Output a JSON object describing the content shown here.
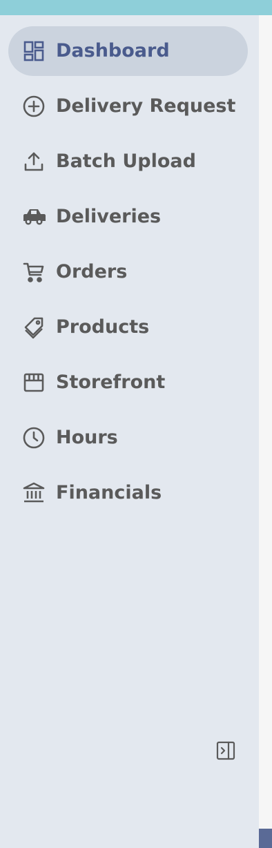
{
  "sidebar": {
    "items": [
      {
        "label": "Dashboard",
        "icon": "dashboard-icon",
        "active": true
      },
      {
        "label": "Delivery Request",
        "icon": "plus-circle-icon",
        "active": false
      },
      {
        "label": "Batch Upload",
        "icon": "upload-icon",
        "active": false
      },
      {
        "label": "Deliveries",
        "icon": "car-icon",
        "active": false
      },
      {
        "label": "Orders",
        "icon": "cart-icon",
        "active": false
      },
      {
        "label": "Products",
        "icon": "tag-icon",
        "active": false
      },
      {
        "label": "Storefront",
        "icon": "storefront-icon",
        "active": false
      },
      {
        "label": "Hours",
        "icon": "clock-icon",
        "active": false
      },
      {
        "label": "Financials",
        "icon": "bank-icon",
        "active": false
      }
    ],
    "collapse_icon": "collapse-sidebar-icon"
  },
  "colors": {
    "top_strip": "#8ecfd9",
    "sidebar_bg": "#e3e8ef",
    "active_bg": "#cbd3de",
    "active_text": "#4a5b8d",
    "item_text": "#5a5a5a",
    "right_accent": "#5a6a96"
  }
}
